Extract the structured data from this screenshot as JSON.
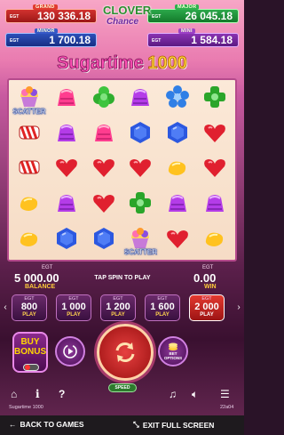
{
  "jackpots": {
    "grand": {
      "label": "GRAND",
      "currency": "EGT",
      "value": "130 336.18"
    },
    "major": {
      "label": "MAJOR",
      "currency": "EGT",
      "value": "26 045.18"
    },
    "minor": {
      "label": "MINOR",
      "currency": "EGT",
      "value": "1 700.18"
    },
    "mini": {
      "label": "MINI",
      "currency": "EGT",
      "value": "1 584.18"
    }
  },
  "brand": {
    "line1": "CLOVER",
    "line2": "Chance"
  },
  "logo": {
    "text": "Sugartime",
    "number": "1000"
  },
  "reels": [
    [
      "scatter",
      "jelly-pink",
      "jelly-pink",
      "cane",
      "cane",
      "bean-yellow"
    ],
    [
      "jelly-green",
      "jelly-green",
      "jelly-purple",
      "heart",
      "heart",
      "gem-blue"
    ],
    [
      "flower-blue",
      "gem-blue",
      "heart",
      "flower-green",
      "heart",
      "gem-blue"
    ],
    [
      "jelly-pink",
      "jelly-purple",
      "heart",
      "bean-yellow",
      "bean-yellow",
      "jelly-purple"
    ],
    [
      "bean-yellow",
      "gem-blue",
      "scatter",
      "jelly-green",
      "flower-green",
      "gem-blue"
    ]
  ],
  "reel_layout": {
    "columns": [
      [
        "scatter",
        "cane",
        "cane",
        "bean-yellow",
        "bean-yellow"
      ],
      [
        "jelly-pink",
        "jelly-purple",
        "heart",
        "jelly-purple",
        "gem-blue"
      ],
      [
        "jelly-green",
        "jelly-pink",
        "heart",
        "heart",
        "gem-blue"
      ],
      [
        "jelly-purple",
        "gem-blue",
        "heart",
        "flower-green",
        "scatter"
      ],
      [
        "flower-blue",
        "gem-blue",
        "bean-yellow",
        "jelly-purple",
        "heart"
      ],
      [
        "flower-green",
        "heart",
        "heart",
        "jelly-purple",
        "bean-yellow"
      ]
    ]
  },
  "scatter_label": "SCATTER",
  "info": {
    "balance_currency": "EGT",
    "balance_value": "5 000.00",
    "balance_label": "BALANCE",
    "tap_text": "TAP SPIN TO PLAY",
    "win_currency": "EGT",
    "win_value": "0.00",
    "win_label": "WIN"
  },
  "bets": [
    {
      "currency": "EGT",
      "value": "800",
      "label": "PLAY",
      "selected": false
    },
    {
      "currency": "EGT",
      "value": "1 000",
      "label": "PLAY",
      "selected": false
    },
    {
      "currency": "EGT",
      "value": "1 200",
      "label": "PLAY",
      "selected": false
    },
    {
      "currency": "EGT",
      "value": "1 600",
      "label": "PLAY",
      "selected": false
    },
    {
      "currency": "EGT",
      "value": "2 000",
      "label": "PLAY",
      "selected": true
    }
  ],
  "controls": {
    "buy_bonus_line1": "BUY",
    "buy_bonus_line2": "BONUS",
    "bet_options_line1": "BET",
    "bet_options_line2": "OPTIONS",
    "speed_label": "SPEED"
  },
  "bottom_bar": {
    "game_title": "Sugartime 1000",
    "version": "22a04"
  },
  "footer": {
    "back_label": "BACK TO GAMES",
    "exit_label": "EXIT FULL SCREEN"
  },
  "colors": {
    "grand": "#c62a2a",
    "major": "#239a41",
    "minor": "#2a4db5",
    "mini": "#7e2fa8",
    "selected_bet": "#d22b2b",
    "accent_gold": "#ffcc3a"
  }
}
